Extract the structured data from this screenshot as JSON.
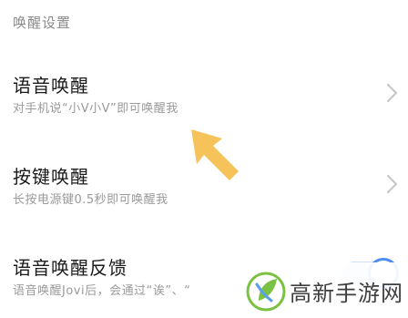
{
  "section": {
    "header": "唤醒设置"
  },
  "settings": {
    "voice_wake": {
      "title": "语音唤醒",
      "subtitle": "对手机说“小V小V”即可唤醒我",
      "chevron_icon": "chevron-right-icon"
    },
    "key_wake": {
      "title": "按键唤醒",
      "subtitle": "长按电源键0.5秒即可唤醒我",
      "chevron_icon": "chevron-right-icon"
    },
    "wake_feedback": {
      "title": "语音唤醒反馈",
      "subtitle": "语音唤醒Jovi后，会通过“诶”、“",
      "toggle_on": true
    }
  },
  "annotation": {
    "arrow_icon": "pointer-arrow-icon",
    "arrow_color": "#f6c35b"
  },
  "watermark": {
    "text": "高新手游网",
    "logo_icon": "leaf-logo-icon"
  },
  "colors": {
    "accent": "#4f8ff0",
    "title": "#1a1a1a",
    "subtitle": "#9a9a9a"
  }
}
